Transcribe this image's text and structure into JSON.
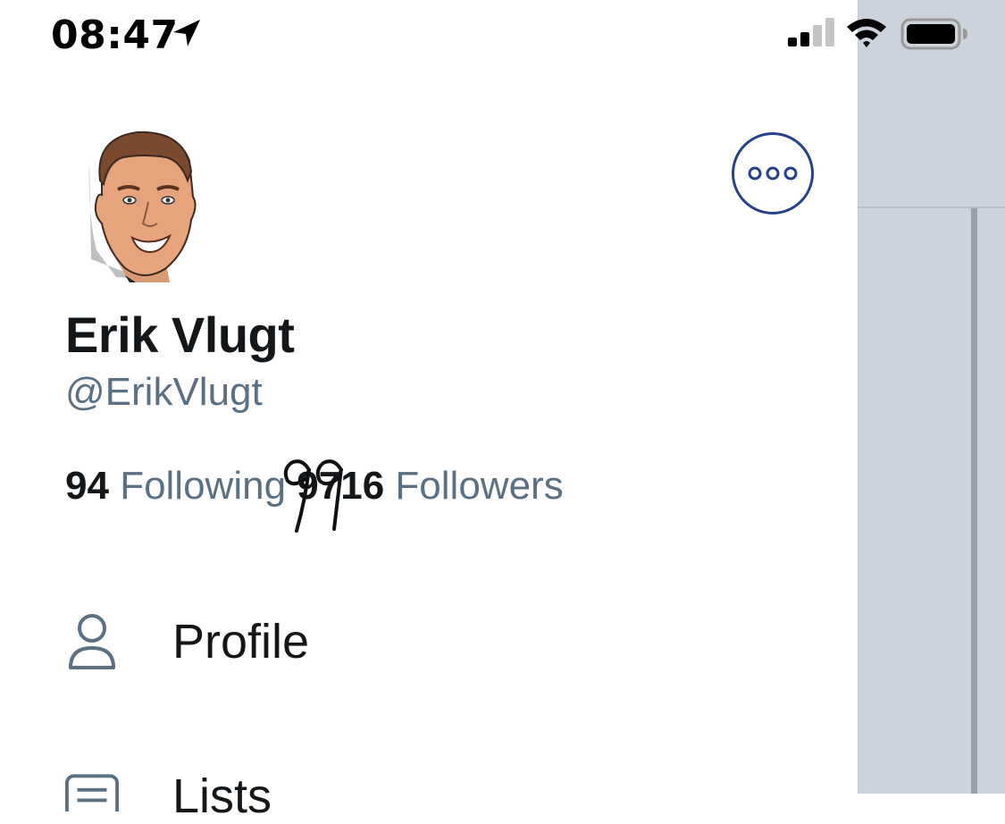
{
  "status_bar": {
    "time": "08:47",
    "icons": [
      "location-arrow-icon",
      "cell-signal-icon",
      "wifi-icon",
      "battery-icon"
    ]
  },
  "profile": {
    "display_name": "Erik Vlugt",
    "handle": "@ErikVlugt",
    "following_count": "94",
    "following_label": "Following",
    "followers_count": "9716",
    "followers_label": "Followers",
    "handwritten_annotation": "99"
  },
  "menu": {
    "items": [
      {
        "label": "Profile",
        "icon": "person-icon"
      },
      {
        "label": "Lists",
        "icon": "list-icon"
      }
    ]
  },
  "colors": {
    "accent": "#27408b",
    "text_primary": "#14171a",
    "text_secondary": "#5b7083",
    "backdrop": "#ccd3dc"
  }
}
